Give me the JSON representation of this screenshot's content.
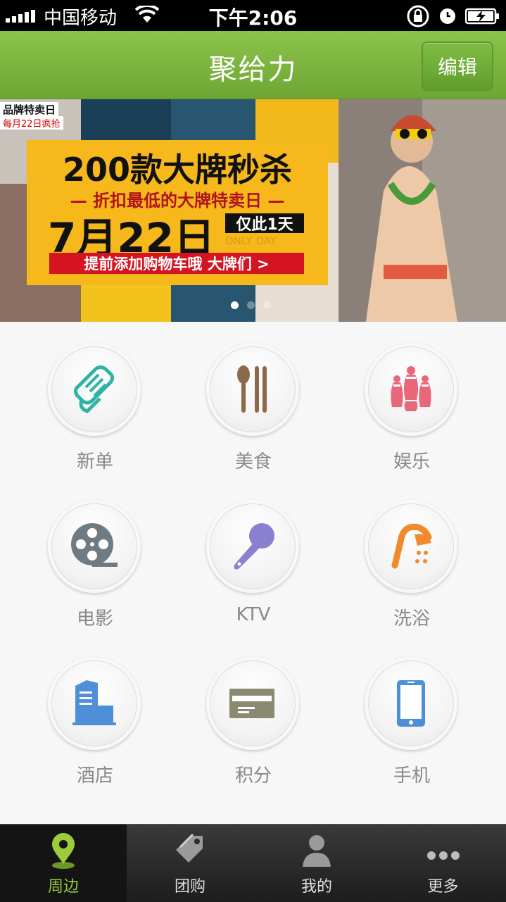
{
  "status_bar": {
    "carrier": "中国移动",
    "time": "下午2:06"
  },
  "header": {
    "title": "聚给力",
    "edit_label": "编辑"
  },
  "banner": {
    "brand_day": "品牌特卖日",
    "brand_day_sub": "每月22日疯抢",
    "headline": "200款大牌秒杀",
    "subline": "— 折扣最低的大牌特卖日 —",
    "date": "7月22日",
    "only_today": "仅此1天",
    "only_day_en": "ONLY DAY",
    "cta": "提前添加购物车哦 大牌们 >",
    "page_count": 3,
    "active_page": 1
  },
  "categories": [
    {
      "label": "新单",
      "icon": "coupon-scroll-icon",
      "color": "#2fb3a3"
    },
    {
      "label": "美食",
      "icon": "spoon-chopsticks-icon",
      "color": "#8a6a4a"
    },
    {
      "label": "娱乐",
      "icon": "bowling-pins-icon",
      "color": "#e8687a"
    },
    {
      "label": "电影",
      "icon": "film-reel-icon",
      "color": "#6f7b82"
    },
    {
      "label": "KTV",
      "icon": "microphone-icon",
      "color": "#8b7fd0"
    },
    {
      "label": "洗浴",
      "icon": "shower-icon",
      "color": "#f08a2c"
    },
    {
      "label": "酒店",
      "icon": "hotel-building-icon",
      "color": "#4f8fd9"
    },
    {
      "label": "积分",
      "icon": "points-card-icon",
      "color": "#8a8a72"
    },
    {
      "label": "手机",
      "icon": "mobile-phone-icon",
      "color": "#4f8fd9"
    }
  ],
  "tabs": [
    {
      "label": "周边",
      "icon": "location-pin-icon",
      "active": true
    },
    {
      "label": "团购",
      "icon": "price-tag-icon",
      "active": false
    },
    {
      "label": "我的",
      "icon": "user-icon",
      "active": false
    },
    {
      "label": "更多",
      "icon": "more-dots-icon",
      "active": false
    }
  ]
}
